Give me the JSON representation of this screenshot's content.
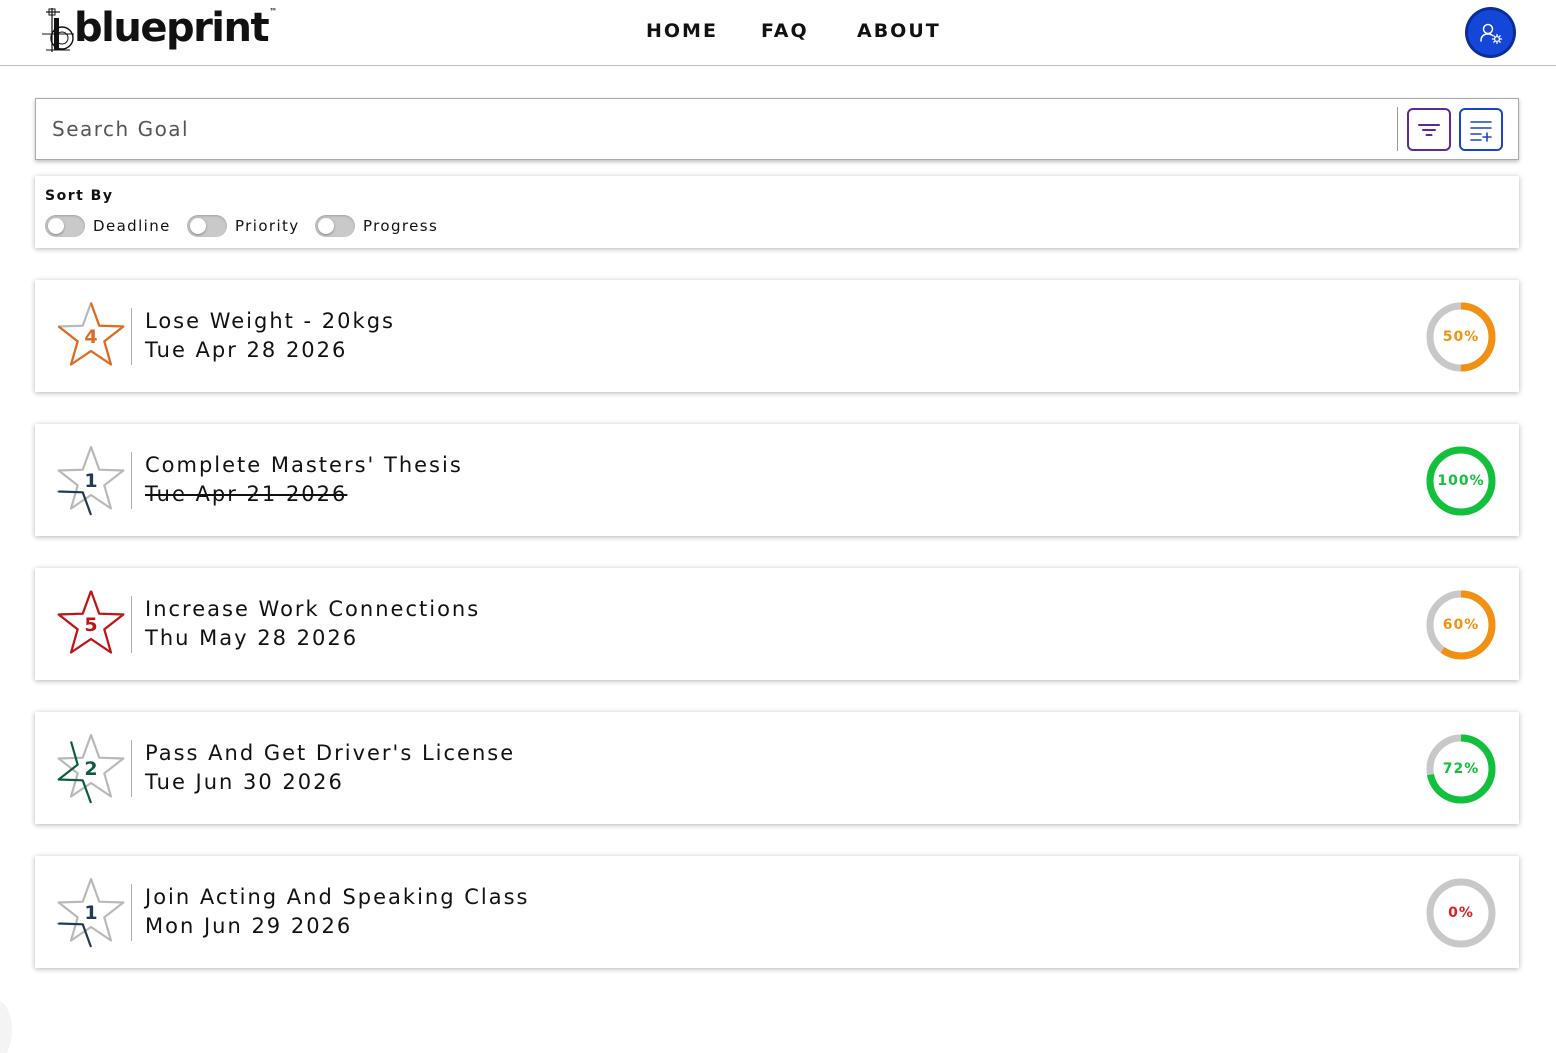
{
  "header": {
    "logo_text": "blueprint",
    "logo_tm": "™",
    "nav": [
      {
        "label": "HOME"
      },
      {
        "label": "FAQ"
      },
      {
        "label": "ABOUT"
      }
    ]
  },
  "search": {
    "placeholder": "Search Goal"
  },
  "sort": {
    "title": "Sort By",
    "options": [
      {
        "label": "Deadline",
        "enabled": false
      },
      {
        "label": "Priority",
        "enabled": false
      },
      {
        "label": "Progress",
        "enabled": false
      }
    ]
  },
  "goals": [
    {
      "priority": "4",
      "title": "Lose Weight - 20kgs",
      "date": "Tue Apr 28 2026",
      "completed": false,
      "progress": 50,
      "progress_label": "50%",
      "priority_color": "#e06a1e",
      "ring_color": "#f29111"
    },
    {
      "priority": "1",
      "title": "Complete Masters' Thesis",
      "date": "Tue Apr 21 2026",
      "completed": true,
      "progress": 100,
      "progress_label": "100%",
      "priority_color": "#233a56",
      "ring_color": "#12c13b"
    },
    {
      "priority": "5",
      "title": "Increase Work Connections",
      "date": "Thu May 28 2026",
      "completed": false,
      "progress": 60,
      "progress_label": "60%",
      "priority_color": "#c01515",
      "ring_color": "#f29111"
    },
    {
      "priority": "2",
      "title": "Pass And Get Driver's License",
      "date": "Tue Jun 30 2026",
      "completed": false,
      "progress": 72,
      "progress_label": "72%",
      "priority_color": "#0d5a42",
      "ring_color": "#12c13b"
    },
    {
      "priority": "1",
      "title": "Join Acting And Speaking Class",
      "date": "Mon Jun 29 2026",
      "completed": false,
      "progress": 0,
      "progress_label": "0%",
      "priority_color": "#233a56",
      "ring_color": "#e02020"
    }
  ],
  "colors": {
    "brand_blue": "#1446d8",
    "filter_purple": "#5b2a9a",
    "ring_track": "#c8c8c8"
  }
}
